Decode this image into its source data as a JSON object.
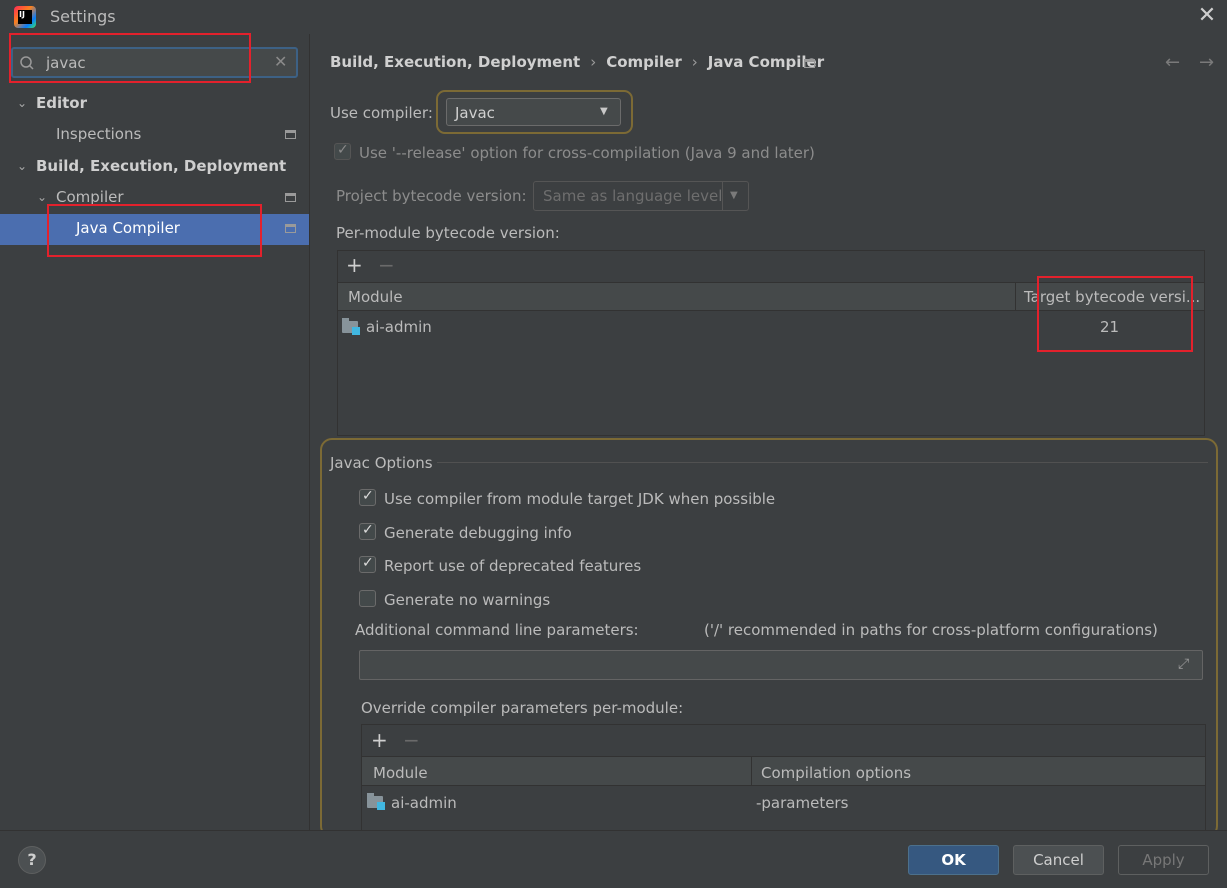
{
  "window": {
    "title": "Settings",
    "logo_text": "IJ"
  },
  "search": {
    "value": "javac",
    "placeholder": ""
  },
  "sidebar": {
    "items": [
      {
        "label": "Editor"
      },
      {
        "label": "Inspections"
      },
      {
        "label": "Build, Execution, Deployment"
      },
      {
        "label": "Compiler"
      },
      {
        "label": "Java Compiler"
      }
    ]
  },
  "breadcrumb": {
    "items": [
      "Build, Execution, Deployment",
      "Compiler",
      "Java Compiler"
    ],
    "separator": "›"
  },
  "compiler": {
    "use_label": "Use compiler:",
    "selected": "Javac",
    "release_option_label": "Use '--release' option for cross-compilation (Java 9 and later)",
    "release_option_checked": true,
    "project_bytecode_label": "Project bytecode version:",
    "project_bytecode_value": "Same as language level",
    "per_module_label": "Per-module bytecode version:"
  },
  "bytecode_table": {
    "columns": [
      "Module",
      "Target bytecode versi..."
    ],
    "rows": [
      {
        "module": "ai-admin",
        "target": "21"
      }
    ]
  },
  "javac_options": {
    "title": "Javac Options",
    "checkboxes": [
      {
        "label": "Use compiler from module target JDK when possible",
        "checked": true
      },
      {
        "label": "Generate debugging info",
        "checked": true
      },
      {
        "label": "Report use of deprecated features",
        "checked": true
      },
      {
        "label": "Generate no warnings",
        "checked": false
      }
    ],
    "cmdline_label": "Additional command line parameters:",
    "cmdline_hint": "('/' recommended in paths for cross-platform configurations)",
    "cmdline_value": "",
    "override_label": "Override compiler parameters per-module:"
  },
  "override_table": {
    "columns": [
      "Module",
      "Compilation options"
    ],
    "rows": [
      {
        "module": "ai-admin",
        "options": "-parameters"
      }
    ]
  },
  "buttons": {
    "ok": "OK",
    "cancel": "Cancel",
    "apply": "Apply",
    "help": "?"
  },
  "icons": {
    "add": "+",
    "remove": "−",
    "chevron_down": "⌄",
    "dropdown_arrow": "▼",
    "close": "✕",
    "back": "←",
    "forward": "→",
    "search": "⚲",
    "clear": "✕",
    "expand": "⤢"
  },
  "colors": {
    "background": "#3c3f41",
    "selection": "#4b6eaf",
    "primary_button": "#365880",
    "annotation_red": "#e3212c",
    "focus_ring": "#7c6a35"
  }
}
